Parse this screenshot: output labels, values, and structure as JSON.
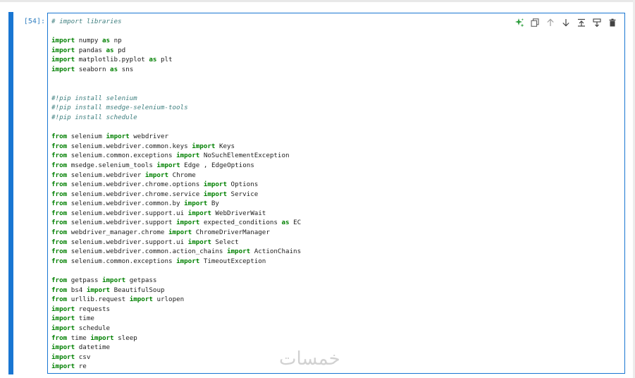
{
  "cell": {
    "prompt": "[54]:",
    "language": "python"
  },
  "toolbar": {
    "icons": [
      "ai-assist-icon",
      "copy-icon",
      "move-up-icon",
      "move-down-icon",
      "insert-above-icon",
      "insert-below-icon",
      "delete-icon"
    ],
    "accent_color": "#1976d2",
    "ai_color": "#2e9e3e"
  },
  "code_lines": [
    "# import libraries",
    "",
    "import numpy as np",
    "import pandas as pd",
    "import matplotlib.pyplot as plt",
    "import seaborn as sns",
    "",
    "",
    "#!pip install selenium",
    "#!pip install msedge-selenium-tools",
    "#!pip install schedule",
    "",
    "from selenium import webdriver",
    "from selenium.webdriver.common.keys import Keys",
    "from selenium.common.exceptions import NoSuchElementException",
    "from msedge.selenium_tools import Edge , EdgeOptions",
    "from selenium.webdriver import Chrome",
    "from selenium.webdriver.chrome.options import Options",
    "from selenium.webdriver.chrome.service import Service",
    "from selenium.webdriver.common.by import By",
    "from selenium.webdriver.support.ui import WebDriverWait",
    "from selenium.webdriver.support import expected_conditions as EC",
    "from webdriver_manager.chrome import ChromeDriverManager",
    "from selenium.webdriver.support.ui import Select",
    "from selenium.webdriver.common.action_chains import ActionChains",
    "from selenium.common.exceptions import TimeoutException",
    "",
    "from getpass import getpass",
    "from bs4 import BeautifulSoup",
    "from urllib.request import urlopen",
    "import requests",
    "import time",
    "import schedule",
    "from time import sleep",
    "import datetime",
    "import csv",
    "import re"
  ],
  "watermark": "خمسات"
}
